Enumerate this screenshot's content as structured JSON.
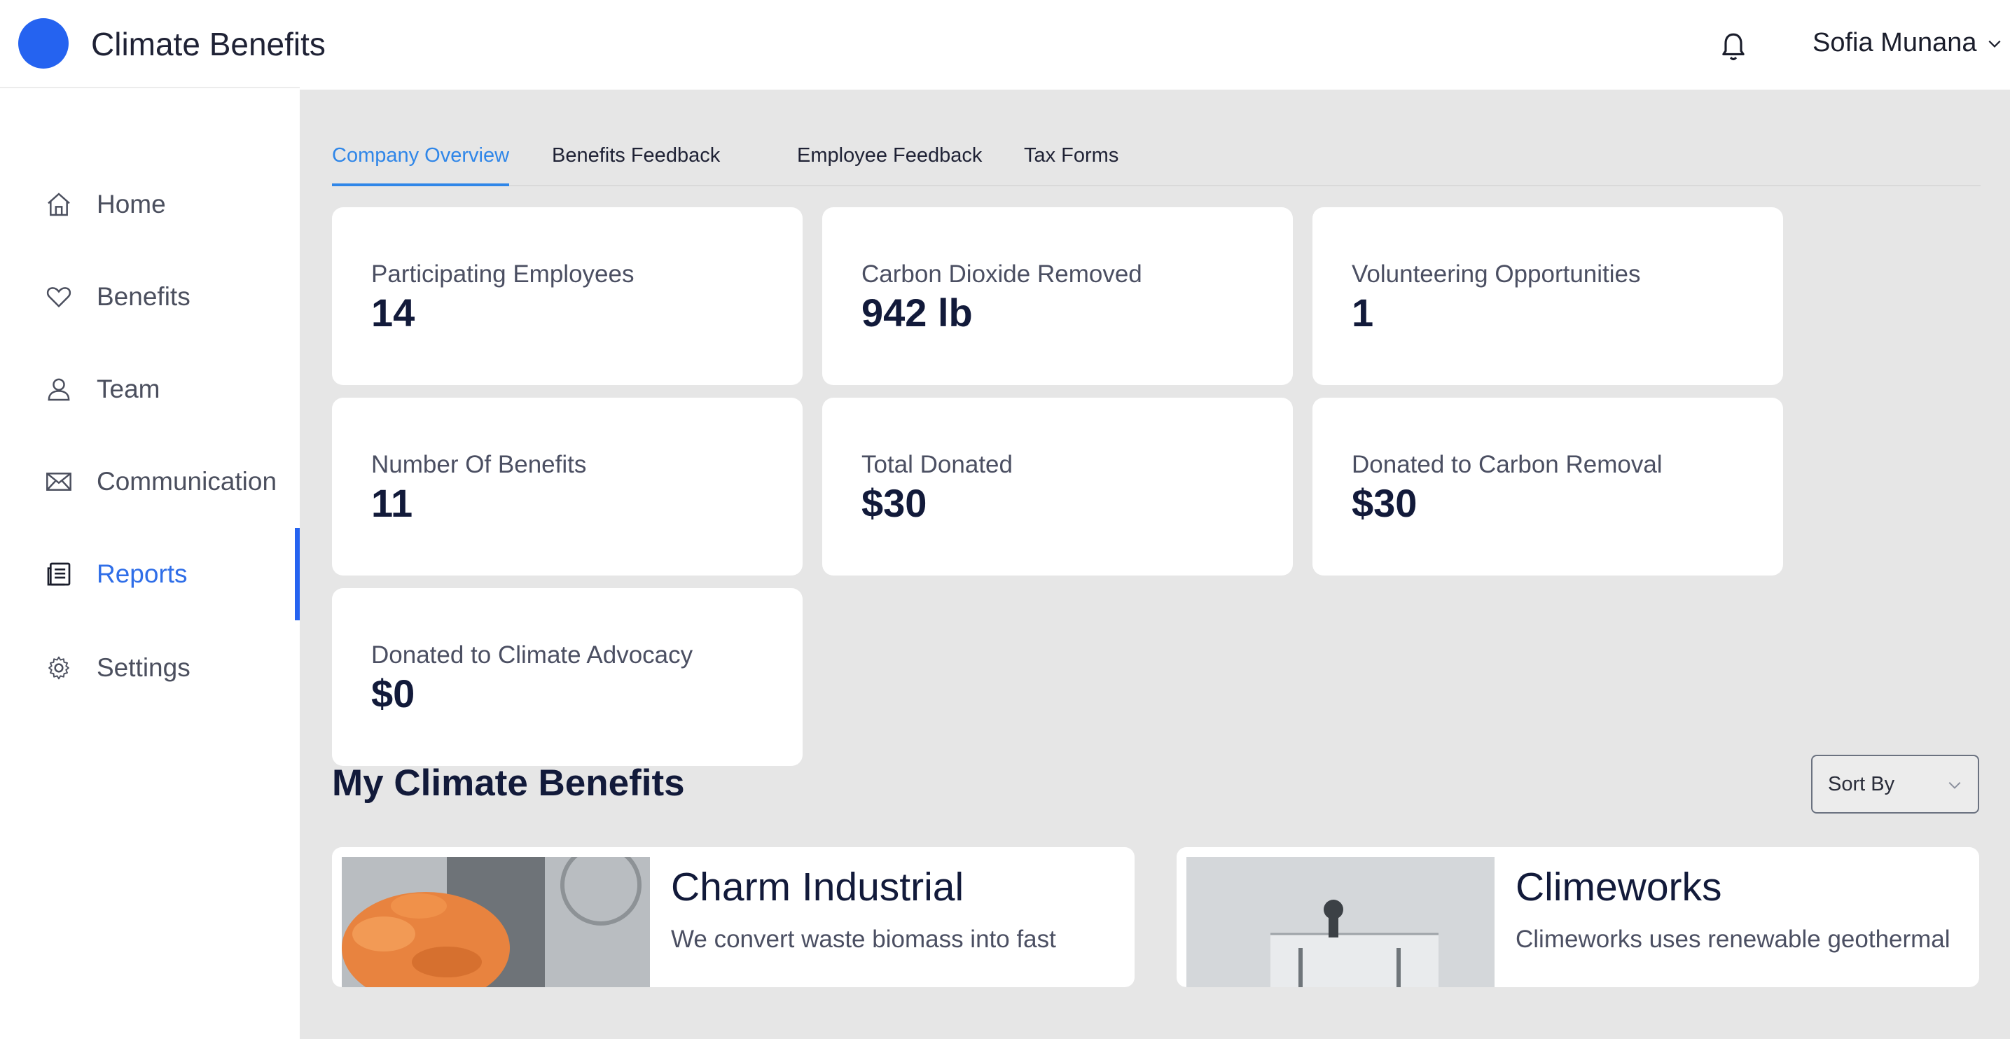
{
  "header": {
    "app_title": "Climate Benefits",
    "user_name": "Sofia Munana",
    "brand_color": "#2563f0"
  },
  "sidebar": {
    "items": [
      {
        "label": "Home",
        "icon": "home-icon"
      },
      {
        "label": "Benefits",
        "icon": "heart-icon"
      },
      {
        "label": "Team",
        "icon": "user-icon"
      },
      {
        "label": "Communication",
        "icon": "mail-icon"
      },
      {
        "label": "Reports",
        "icon": "report-icon",
        "active": true
      },
      {
        "label": "Settings",
        "icon": "gear-icon"
      }
    ]
  },
  "tabs": [
    {
      "label": "Company Overview",
      "active": true
    },
    {
      "label": "Benefits Feedback"
    },
    {
      "label": "Employee Feedback"
    },
    {
      "label": "Tax Forms"
    }
  ],
  "stats": [
    {
      "label": "Participating Employees",
      "value": "14"
    },
    {
      "label": "Carbon Dioxide Removed",
      "value": "942 lb"
    },
    {
      "label": "Volunteering Opportunities",
      "value": "1"
    },
    {
      "label": "Number Of Benefits",
      "value": "11"
    },
    {
      "label": "Total Donated",
      "value": "$30"
    },
    {
      "label": "Donated to Carbon Removal",
      "value": "$30"
    },
    {
      "label": "Donated to Climate Advocacy",
      "value": "$0"
    }
  ],
  "benefits_section": {
    "title": "My Climate Benefits",
    "sort_label": "Sort By",
    "items": [
      {
        "name": "Charm Industrial",
        "description": "We convert waste biomass into fast"
      },
      {
        "name": "Climeworks",
        "description": "Climeworks uses renewable geothermal"
      }
    ]
  }
}
